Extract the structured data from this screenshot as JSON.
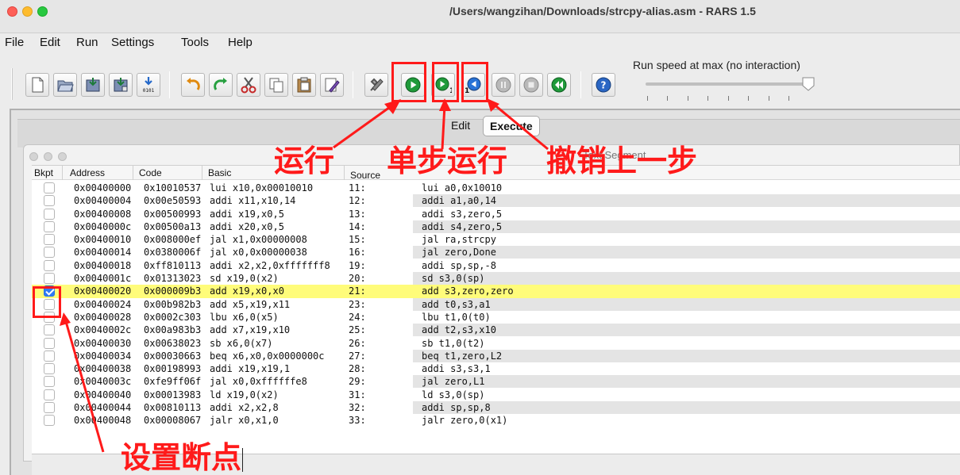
{
  "window": {
    "title": "/Users/wangzihan/Downloads/strcpy-alias.asm  - RARS 1.5"
  },
  "menu": [
    "File",
    "Edit",
    "Run",
    "Settings",
    "Tools",
    "Help"
  ],
  "toolbar": {
    "run_speed_label": "Run speed at max (no interaction)",
    "step_badge": "1",
    "backstep_badge": "1",
    "icons": [
      "new-file-icon",
      "open-file-icon",
      "save-icon",
      "save-as-icon",
      "dump-memory-icon",
      "undo-icon",
      "redo-icon",
      "cut-icon",
      "copy-icon",
      "paste-icon",
      "find-replace-icon",
      "assemble-icon",
      "run-icon",
      "step-icon",
      "backstep-icon",
      "pause-icon",
      "stop-icon",
      "reset-icon",
      "help-icon"
    ]
  },
  "tabs": [
    {
      "label": "Edit",
      "active": false
    },
    {
      "label": "Execute",
      "active": true
    }
  ],
  "segment": {
    "title": "Text Segment"
  },
  "table": {
    "headers": [
      "Bkpt",
      "Address",
      "Code",
      "Basic",
      "Source"
    ],
    "rows": [
      {
        "bkpt": false,
        "address": "0x00400000",
        "code": "0x10010537",
        "basic": "lui x10,0x00010010",
        "line": "11:",
        "source": "lui     a0,0x10010",
        "highlight": false
      },
      {
        "bkpt": false,
        "address": "0x00400004",
        "code": "0x00e50593",
        "basic": "addi x11,x10,14",
        "line": "12:",
        "source": "addi    a1,a0,14",
        "highlight": false
      },
      {
        "bkpt": false,
        "address": "0x00400008",
        "code": "0x00500993",
        "basic": "addi x19,x0,5",
        "line": "13:",
        "source": "addi s3,zero,5",
        "highlight": false
      },
      {
        "bkpt": false,
        "address": "0x0040000c",
        "code": "0x00500a13",
        "basic": "addi x20,x0,5",
        "line": "14:",
        "source": "addi s4,zero,5",
        "highlight": false
      },
      {
        "bkpt": false,
        "address": "0x00400010",
        "code": "0x008000ef",
        "basic": "jal x1,0x00000008",
        "line": "15:",
        "source": "jal     ra,strcpy",
        "highlight": false
      },
      {
        "bkpt": false,
        "address": "0x00400014",
        "code": "0x0380006f",
        "basic": "jal x0,0x00000038",
        "line": "16:",
        "source": "jal     zero,Done",
        "highlight": false
      },
      {
        "bkpt": false,
        "address": "0x00400018",
        "code": "0xff810113",
        "basic": "addi x2,x2,0xfffffff8",
        "line": "19:",
        "source": "addi sp,sp,-8",
        "highlight": false
      },
      {
        "bkpt": false,
        "address": "0x0040001c",
        "code": "0x01313023",
        "basic": "sd x19,0(x2)",
        "line": "20:",
        "source": "sd s3,0(sp)",
        "highlight": false
      },
      {
        "bkpt": true,
        "address": "0x00400020",
        "code": "0x000009b3",
        "basic": "add x19,x0,x0",
        "line": "21:",
        "source": "add s3,zero,zero",
        "highlight": true
      },
      {
        "bkpt": false,
        "address": "0x00400024",
        "code": "0x00b982b3",
        "basic": "add x5,x19,x11",
        "line": "23:",
        "source": "add t0,s3,a1",
        "highlight": false
      },
      {
        "bkpt": false,
        "address": "0x00400028",
        "code": "0x0002c303",
        "basic": "lbu x6,0(x5)",
        "line": "24:",
        "source": "lbu t1,0(t0)",
        "highlight": false
      },
      {
        "bkpt": false,
        "address": "0x0040002c",
        "code": "0x00a983b3",
        "basic": "add x7,x19,x10",
        "line": "25:",
        "source": "add t2,s3,x10",
        "highlight": false
      },
      {
        "bkpt": false,
        "address": "0x00400030",
        "code": "0x00638023",
        "basic": "sb x6,0(x7)",
        "line": "26:",
        "source": "sb t1,0(t2)",
        "highlight": false
      },
      {
        "bkpt": false,
        "address": "0x00400034",
        "code": "0x00030663",
        "basic": "beq x6,x0,0x0000000c",
        "line": "27:",
        "source": "beq t1,zero,L2",
        "highlight": false
      },
      {
        "bkpt": false,
        "address": "0x00400038",
        "code": "0x00198993",
        "basic": "addi x19,x19,1",
        "line": "28:",
        "source": "addi s3,s3,1",
        "highlight": false
      },
      {
        "bkpt": false,
        "address": "0x0040003c",
        "code": "0xfe9ff06f",
        "basic": "jal x0,0xffffffe8",
        "line": "29:",
        "source": "jal zero,L1",
        "highlight": false
      },
      {
        "bkpt": false,
        "address": "0x00400040",
        "code": "0x00013983",
        "basic": "ld x19,0(x2)",
        "line": "31:",
        "source": "ld s3,0(sp)",
        "highlight": false
      },
      {
        "bkpt": false,
        "address": "0x00400044",
        "code": "0x00810113",
        "basic": "addi x2,x2,8",
        "line": "32:",
        "source": "addi sp,sp,8",
        "highlight": false
      },
      {
        "bkpt": false,
        "address": "0x00400048",
        "code": "0x00008067",
        "basic": "jalr x0,x1,0",
        "line": "33:",
        "source": "jalr zero,0(x1)",
        "highlight": false
      }
    ]
  },
  "annotations": {
    "run": "运行",
    "step": "单步运行",
    "backstep": "撤销上一步",
    "breakpoint": "设置断点",
    "color": "#ff1a1a"
  }
}
